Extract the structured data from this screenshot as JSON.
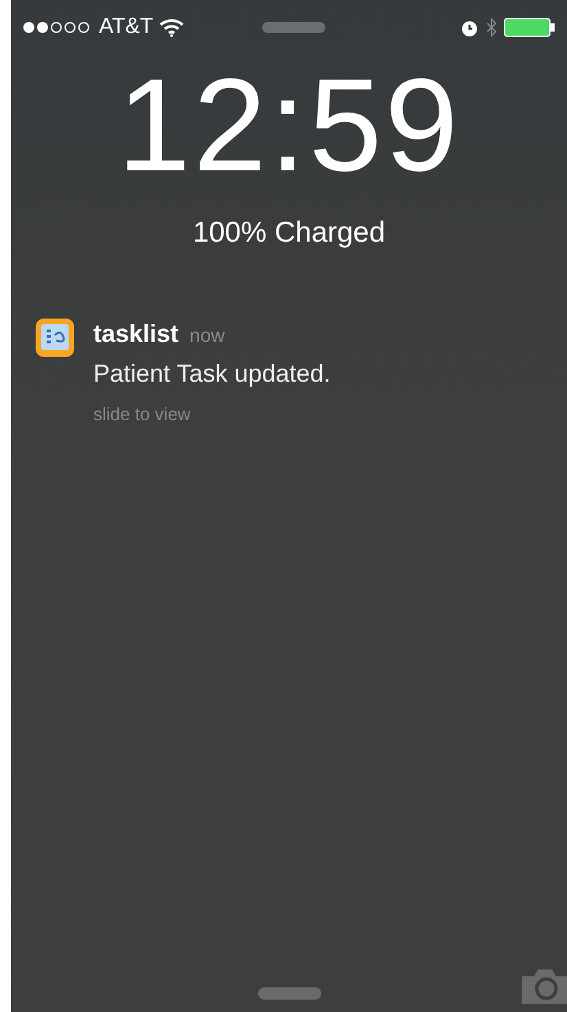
{
  "status_bar": {
    "carrier": "AT&T"
  },
  "clock": {
    "time": "12:59",
    "battery_status": "100% Charged"
  },
  "notifications": [
    {
      "app": "tasklist",
      "time": "now",
      "message": "Patient Task updated.",
      "hint": "slide to view"
    }
  ]
}
